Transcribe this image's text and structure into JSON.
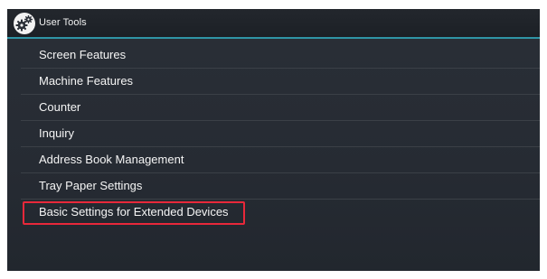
{
  "header": {
    "title": "User Tools",
    "icon": "gear-icon"
  },
  "menu": {
    "items": [
      {
        "label": "Screen Features"
      },
      {
        "label": "Machine Features"
      },
      {
        "label": "Counter"
      },
      {
        "label": "Inquiry"
      },
      {
        "label": "Address Book Management"
      },
      {
        "label": "Tray Paper Settings"
      },
      {
        "label": "Basic Settings for Extended Devices",
        "selected": true
      }
    ]
  },
  "colors": {
    "accent_line": "#2f95a6",
    "highlight": "#e8283a",
    "background": "#272c34"
  }
}
